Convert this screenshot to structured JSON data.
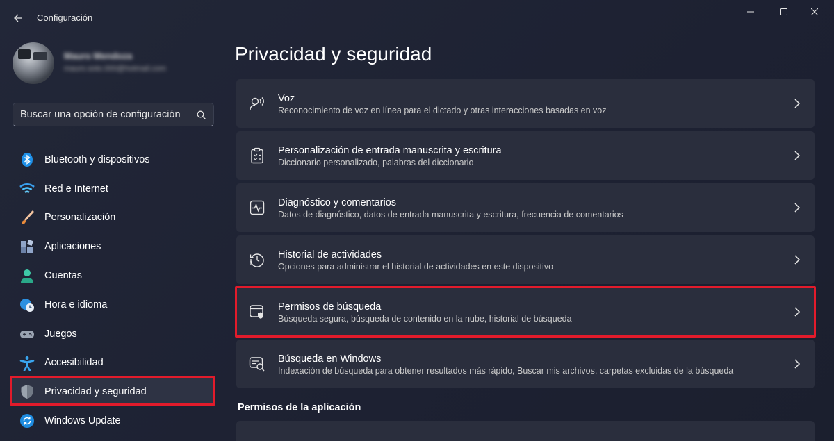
{
  "window": {
    "app_title": "Configuración",
    "controls": {
      "minimize_icon": "minimize-icon",
      "maximize_icon": "maximize-icon",
      "close_icon": "close-icon"
    }
  },
  "profile": {
    "name": "Mauro Mendoza",
    "email": "mauro.soto.000@hotmail.com"
  },
  "search": {
    "placeholder": "Buscar una opción de configuración",
    "value": ""
  },
  "sidebar": {
    "items": [
      {
        "label": "Bluetooth y dispositivos",
        "icon": "bluetooth-icon",
        "selected": false
      },
      {
        "label": "Red e Internet",
        "icon": "wifi-icon",
        "selected": false
      },
      {
        "label": "Personalización",
        "icon": "brush-icon",
        "selected": false
      },
      {
        "label": "Aplicaciones",
        "icon": "apps-icon",
        "selected": false
      },
      {
        "label": "Cuentas",
        "icon": "person-icon",
        "selected": false
      },
      {
        "label": "Hora e idioma",
        "icon": "globe-clock-icon",
        "selected": false
      },
      {
        "label": "Juegos",
        "icon": "gamepad-icon",
        "selected": false
      },
      {
        "label": "Accesibilidad",
        "icon": "accessibility-icon",
        "selected": false
      },
      {
        "label": "Privacidad y seguridad",
        "icon": "shield-icon",
        "selected": true
      },
      {
        "label": "Windows Update",
        "icon": "update-icon",
        "selected": false
      }
    ]
  },
  "main": {
    "title": "Privacidad y seguridad",
    "cards": [
      {
        "title": "Voz",
        "desc": "Reconocimiento de voz en línea para el dictado y otras interacciones basadas en voz",
        "icon": "voice-icon"
      },
      {
        "title": "Personalización de entrada manuscrita y escritura",
        "desc": "Diccionario personalizado, palabras del diccionario",
        "icon": "clipboard-icon"
      },
      {
        "title": "Diagnóstico y comentarios",
        "desc": "Datos de diagnóstico, datos de entrada manuscrita y escritura, frecuencia de comentarios",
        "icon": "pulse-icon"
      },
      {
        "title": "Historial de actividades",
        "desc": "Opciones para administrar el historial de actividades en este dispositivo",
        "icon": "history-icon"
      },
      {
        "title": "Permisos de búsqueda",
        "desc": "Búsqueda segura, búsqueda de contenido en la nube, historial de búsqueda",
        "icon": "search-shield-icon"
      },
      {
        "title": "Búsqueda en Windows",
        "desc": "Indexación de búsqueda para obtener resultados más rápido, Buscar mis archivos, carpetas excluidas de la búsqueda",
        "icon": "search-window-icon"
      }
    ],
    "section_title": "Permisos de la aplicación"
  },
  "colors": {
    "accent": "#4cc2ff",
    "highlight": "#e21b2b",
    "background": "#1d2132",
    "card": "#2a2e3d"
  }
}
